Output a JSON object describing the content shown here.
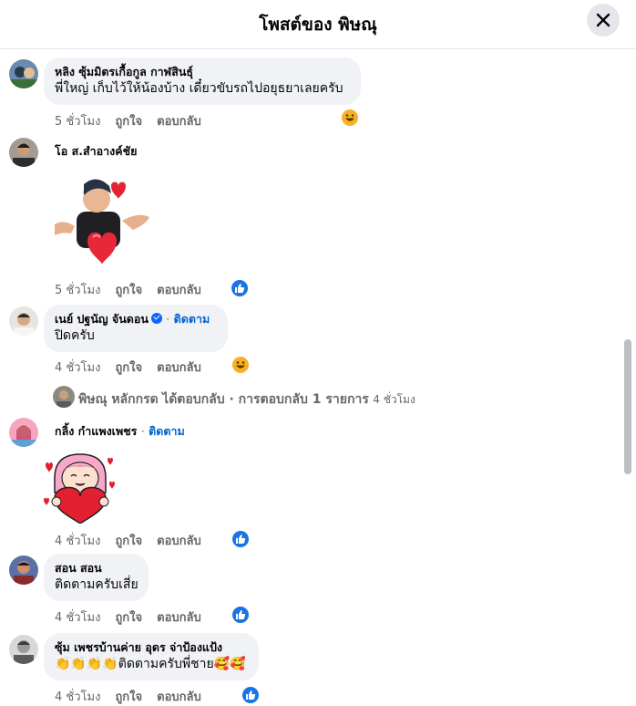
{
  "header": {
    "title": "โพสต์ของ พิษณุ",
    "close_icon": "close-icon"
  },
  "comments": [
    {
      "name": "หลิง ซุ้มมิตรเกื้อกูล กาฬสินธุ์",
      "text": "พี่ใหญ่ เก็บไว้ให้น้องบ้าง เดี๋ยวขับรถไปอยุธยาเลยครับ",
      "time": "5 ชั่วโมง",
      "like": "ถูกใจ",
      "reply": "ตอบกลับ",
      "reaction": "haha"
    },
    {
      "name": "โอ ส.สำอางค์ชัย",
      "sticker": "man-with-hearts-sticker",
      "time": "5 ชั่วโมง",
      "like": "ถูกใจ",
      "reply": "ตอบกลับ",
      "reaction": "like"
    },
    {
      "name": "เนย์ ปฐนัญ จันดอน",
      "follow": "ติดตาม",
      "text": "ปิดครับ",
      "time": "4 ชั่วโมง",
      "like": "ถูกใจ",
      "reply": "ตอบกลับ",
      "reaction": "haha"
    },
    {
      "name": "กลิ้ง กำแพงเพชร",
      "follow": "ติดตาม",
      "sticker": "girl-holding-heart-sticker",
      "time": "4 ชั่วโมง",
      "like": "ถูกใจ",
      "reply": "ตอบกลับ",
      "reaction": "like"
    },
    {
      "name": "สอน สอน",
      "text": "ติดตามครับเสี่ย",
      "time": "4 ชั่วโมง",
      "like": "ถูกใจ",
      "reply": "ตอบกลับ",
      "reaction": "like"
    },
    {
      "name": "ซุ้ม เพชรบ้านค่าย อุดร จ่าป้องแป้ง",
      "text": "👏👏👏👏ติดตามครับพี่ชาย🥰🥰",
      "time": "4 ชั่วโมง",
      "like": "ถูกใจ",
      "reply": "ตอบกลับ",
      "reaction": "like"
    }
  ],
  "reply_summary": {
    "author": "พิษณุ หลักกรด",
    "action": "ได้ตอบกลับ · การตอบกลับ 1 รายการ",
    "time": "4 ชั่วโมง"
  },
  "colors": {
    "like_blue": "#1b74e4",
    "haha_yellow": "#f7b125",
    "follow_blue": "#0064d1",
    "bubble_gray": "#f0f2f5",
    "meta_gray": "#65676b"
  }
}
